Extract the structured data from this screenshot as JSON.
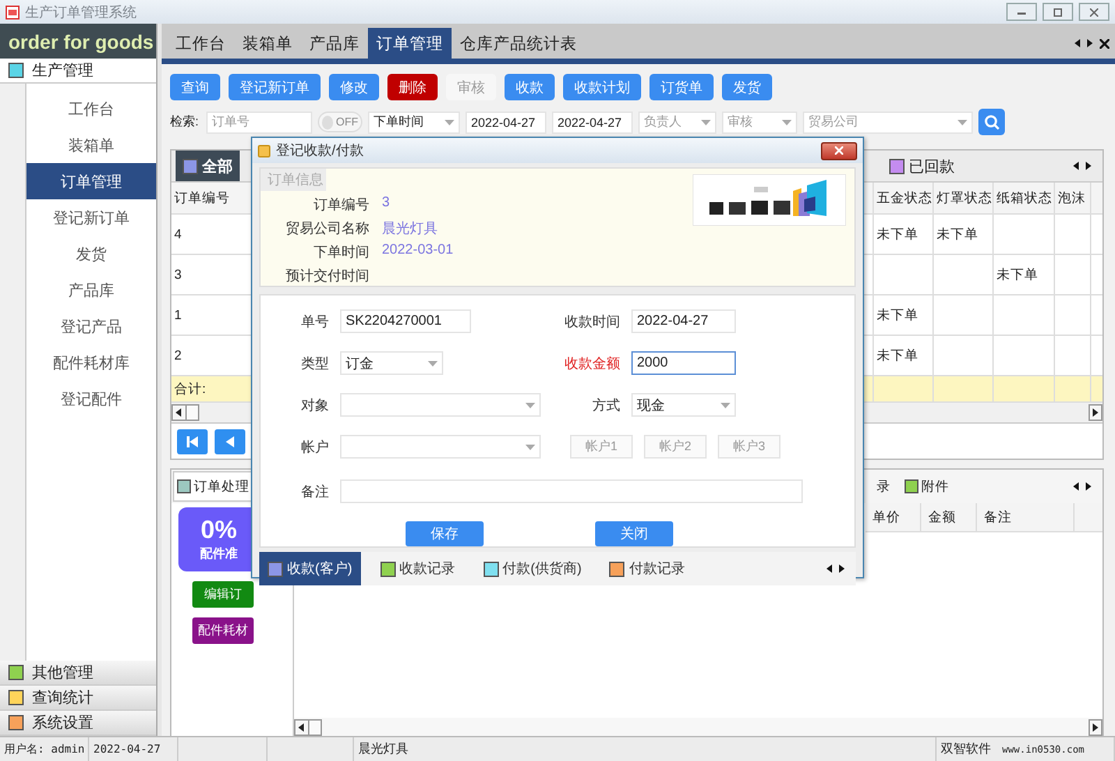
{
  "window": {
    "title": "生产订单管理系统"
  },
  "sidebar": {
    "logo": "order for goods",
    "groups": [
      {
        "label": "生产管理",
        "color": "#5ad4e6",
        "expanded": true,
        "items": [
          {
            "label": "工作台",
            "selected": false
          },
          {
            "label": "装箱单",
            "selected": false
          },
          {
            "label": "订单管理",
            "selected": true
          },
          {
            "label": "登记新订单",
            "selected": false
          },
          {
            "label": "发货",
            "selected": false
          },
          {
            "label": "产品库",
            "selected": false
          },
          {
            "label": "登记产品",
            "selected": false
          },
          {
            "label": "配件耗材库",
            "selected": false
          },
          {
            "label": "登记配件",
            "selected": false
          }
        ]
      },
      {
        "label": "其他管理",
        "color": "#8fd14f",
        "expanded": false
      },
      {
        "label": "查询统计",
        "color": "#ffd45a",
        "expanded": false
      },
      {
        "label": "系统设置",
        "color": "#f7a15a",
        "expanded": false
      }
    ]
  },
  "tabs": [
    {
      "label": "工作台",
      "selected": false
    },
    {
      "label": "装箱单",
      "selected": false
    },
    {
      "label": "产品库",
      "selected": false
    },
    {
      "label": "订单管理",
      "selected": true
    },
    {
      "label": "仓库产品统计表",
      "selected": false
    }
  ],
  "toolbar": [
    {
      "label": "查询",
      "kind": "primary"
    },
    {
      "label": "登记新订单",
      "kind": "primary"
    },
    {
      "label": "修改",
      "kind": "primary"
    },
    {
      "label": "删除",
      "kind": "danger"
    },
    {
      "label": "审核",
      "kind": "disabled"
    },
    {
      "label": "收款",
      "kind": "primary"
    },
    {
      "label": "收款计划",
      "kind": "primary"
    },
    {
      "label": "订货单",
      "kind": "primary"
    },
    {
      "label": "发货",
      "kind": "primary"
    }
  ],
  "search": {
    "label": "检索:",
    "order_no": {
      "placeholder": "订单号"
    },
    "toggle": {
      "label": "OFF",
      "on": false
    },
    "date_type": "下单时间",
    "date_from": "2022-04-27",
    "date_to": "2022-04-27",
    "owner": {
      "placeholder": "负责人"
    },
    "state": {
      "placeholder": "审核"
    },
    "company": {
      "placeholder": "贸易公司"
    }
  },
  "filters": [
    {
      "label": "全部",
      "color": "#8c96e6",
      "selected": true
    },
    {
      "label": "已回款",
      "color": "#c48cf0",
      "selected": false
    }
  ],
  "orders": {
    "columns": [
      "订单编号",
      "五金状态",
      "灯罩状态",
      "纸箱状态",
      "泡沫"
    ],
    "rows": [
      {
        "order_no": "4",
        "hardware": "未下单",
        "lampshade": "未下单"
      },
      {
        "order_no": "3",
        "carton": "未下单"
      },
      {
        "order_no": "1",
        "hardware": "未下单"
      },
      {
        "order_no": "2",
        "hardware": "未下单"
      }
    ],
    "total_label": "合计:"
  },
  "detail": {
    "tabs": [
      {
        "label": "订单处理",
        "color": "#9cc8c0",
        "selected": true
      },
      {
        "label": "录",
        "selected": false
      },
      {
        "label": "附件",
        "color": "#8fd14f",
        "selected": false
      }
    ],
    "progress": {
      "percent": "0%",
      "label": "配件准"
    },
    "actions": [
      {
        "label": "编辑订",
        "color": "#128a12"
      },
      {
        "label": "配件耗材",
        "color": "#8a128a"
      }
    ],
    "columns": [
      "单价",
      "金额",
      "备注"
    ]
  },
  "status_bar": {
    "user": "用户名: admin",
    "date": "2022-04-27",
    "company": "晨光灯具",
    "vendor": "双智软件",
    "site": "www.in0530.com"
  },
  "dialog": {
    "title": "登记收款/付款",
    "info_tab": "订单信息",
    "info": [
      {
        "label": "订单编号",
        "value": "3"
      },
      {
        "label": "贸易公司名称",
        "value": "晨光灯具"
      },
      {
        "label": "下单时间",
        "value": "2022-03-01"
      },
      {
        "label": "预计交付时间"
      }
    ],
    "logo": {
      "kind": "picture"
    },
    "form": {
      "number": {
        "label": "单号",
        "value": "SK2204270001"
      },
      "time": {
        "label": "收款时间",
        "value": "2022-04-27"
      },
      "type": {
        "label": "类型",
        "value": "订金"
      },
      "amount": {
        "label": "收款金额",
        "value": "2000",
        "required": true,
        "focused": true
      },
      "target": {
        "label": "对象"
      },
      "method": {
        "label": "方式",
        "value": "现金"
      },
      "account": {
        "label": "帐户"
      },
      "account_buttons": [
        {
          "label": "帐户1",
          "disabled": true
        },
        {
          "label": "帐户2",
          "disabled": true
        },
        {
          "label": "帐户3",
          "disabled": true
        }
      ],
      "note": {
        "label": "备注"
      }
    },
    "buttons": [
      "保存",
      "关闭"
    ],
    "tabs": [
      {
        "label": "收款(客户)",
        "color": "#8c96e6",
        "selected": true
      },
      {
        "label": "收款记录",
        "color": "#8fd14f",
        "selected": false
      },
      {
        "label": "付款(供货商)",
        "color": "#7fe0f0",
        "selected": false
      },
      {
        "label": "付款记录",
        "color": "#f7a15a",
        "selected": false
      }
    ]
  }
}
